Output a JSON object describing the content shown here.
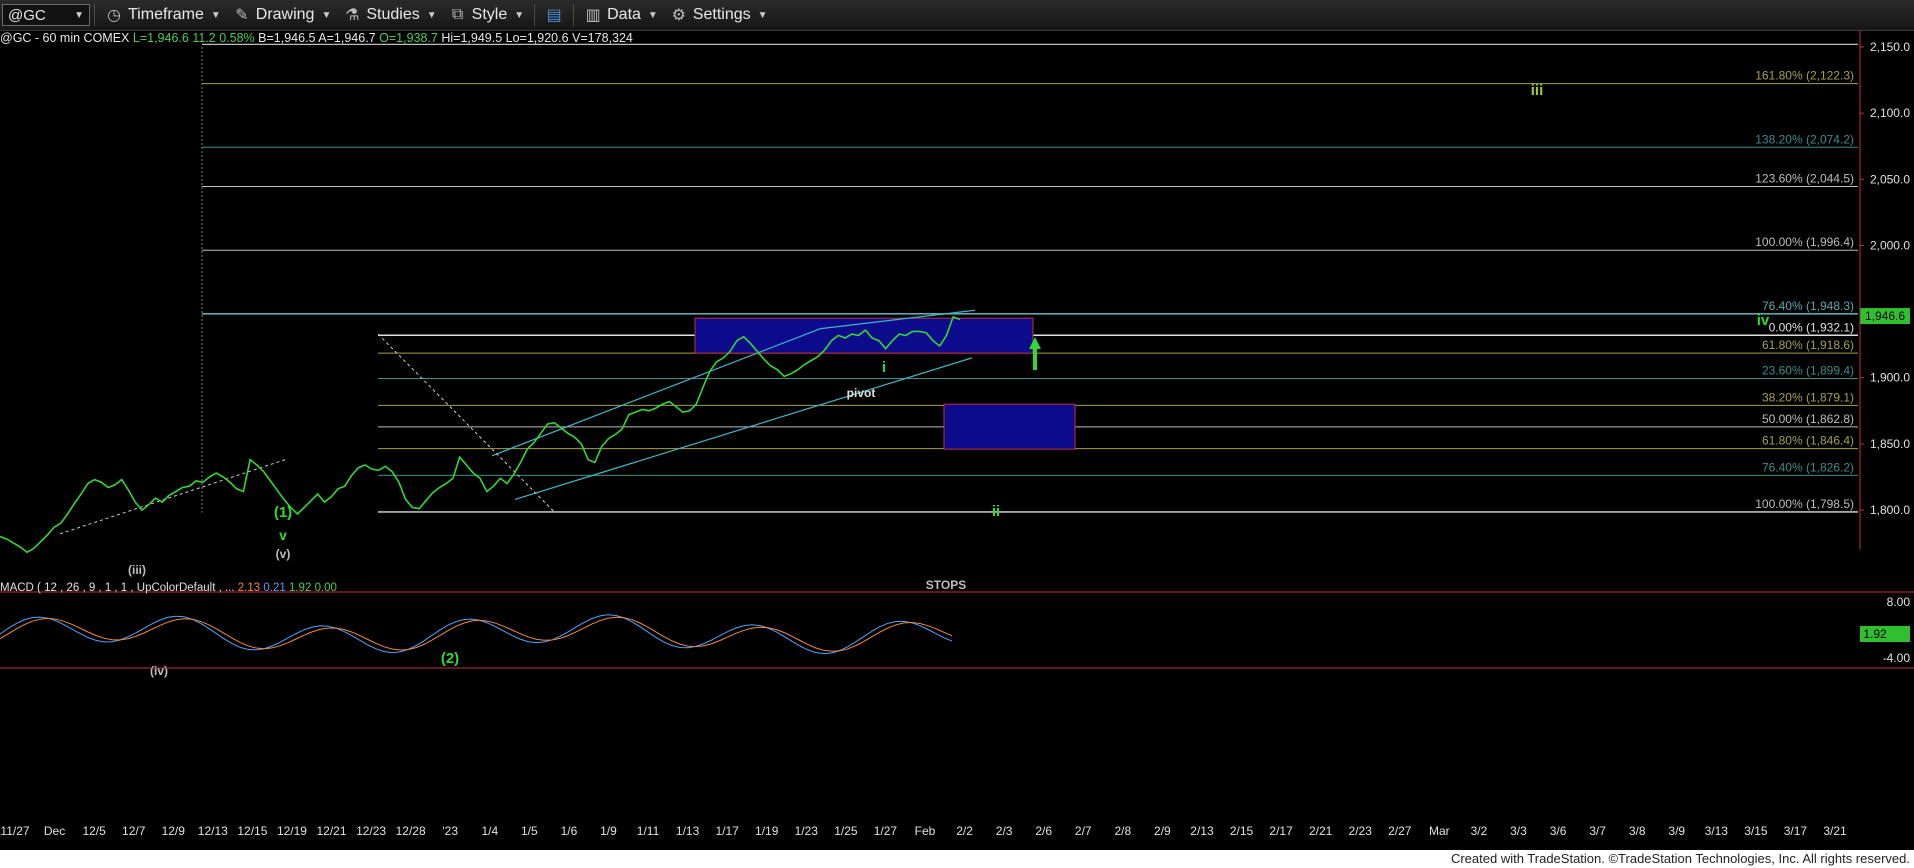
{
  "toolbar": {
    "symbol": "@GC",
    "timeframe": "Timeframe",
    "drawing": "Drawing",
    "studies": "Studies",
    "style": "Style",
    "data": "Data",
    "settings": "Settings"
  },
  "info": {
    "symbol_line": "@GC - 60 min  COMEX",
    "last": "L=1,946.6",
    "change": "11.2",
    "pct": "0.58%",
    "bid": "B=1,946.5",
    "ask": "A=1,946.7",
    "open": "O=1,938.7",
    "high": "Hi=1,949.5",
    "low": "Lo=1,920.6",
    "volume": "V=178,324"
  },
  "macd": {
    "label": "MACD ( 12 , 26 , 9 , 1 , 1 , UpColorDefault , ...",
    "v1": "2.13",
    "v2": "0.21",
    "v3": "1.92",
    "v4": "0.00",
    "ticks": [
      "8.00",
      "-4.00"
    ],
    "current": "1.92"
  },
  "footer": "Created with TradeStation. ©TradeStation Technologies, Inc. All rights reserved.",
  "chart_data": {
    "type": "line",
    "title": "@GC - 60 min",
    "ylim": [
      1770,
      2160
    ],
    "y_ticks": [
      "2,150.0",
      "2,100.0",
      "2,050.0",
      "2,000.0",
      "1,900.0",
      "1,850.0",
      "1,800.0"
    ],
    "last_price": "1,946.6",
    "x_ticks": [
      "11/27",
      "Dec",
      "12/5",
      "12/7",
      "12/9",
      "12/13",
      "12/15",
      "12/19",
      "12/21",
      "12/23",
      "12/28",
      "'23",
      "1/4",
      "1/5",
      "1/6",
      "1/9",
      "1/11",
      "1/13",
      "1/17",
      "1/19",
      "1/23",
      "1/25",
      "1/27",
      "Feb",
      "2/2",
      "2/3",
      "2/6",
      "2/7",
      "2/8",
      "2/9",
      "2/13",
      "2/15",
      "2/17",
      "2/21",
      "2/23",
      "2/27",
      "Mar",
      "3/2",
      "3/3",
      "3/6",
      "3/7",
      "3/8",
      "3/9",
      "3/13",
      "3/15",
      "3/17",
      "3/21"
    ],
    "series": [
      {
        "values": [
          1780,
          1778,
          1775,
          1772,
          1768,
          1771,
          1776,
          1781,
          1787,
          1790,
          1797,
          1805,
          1812,
          1820,
          1823,
          1821,
          1817,
          1819,
          1823,
          1815,
          1806,
          1800,
          1804,
          1809,
          1806,
          1811,
          1814,
          1817,
          1818,
          1822,
          1821,
          1825,
          1828,
          1825,
          1821,
          1816,
          1814,
          1838,
          1834,
          1829,
          1822,
          1815,
          1808,
          1802,
          1797,
          1802,
          1807,
          1812,
          1806,
          1810,
          1816,
          1818,
          1826,
          1832,
          1834,
          1831,
          1830,
          1833,
          1829,
          1821,
          1808,
          1802,
          1801,
          1807,
          1813,
          1817,
          1820,
          1824,
          1840,
          1834,
          1828,
          1824,
          1814,
          1818,
          1824,
          1820,
          1827,
          1836,
          1846,
          1851,
          1858,
          1865,
          1866,
          1862,
          1858,
          1855,
          1850,
          1838,
          1836,
          1848,
          1854,
          1857,
          1861,
          1872,
          1874,
          1876,
          1875,
          1877,
          1880,
          1882,
          1878,
          1874,
          1875,
          1880,
          1893,
          1905,
          1912,
          1915,
          1920,
          1928,
          1931,
          1926,
          1920,
          1914,
          1909,
          1906,
          1901,
          1903,
          1906,
          1910,
          1913,
          1916,
          1921,
          1928,
          1932,
          1930,
          1933,
          1932,
          1936,
          1930,
          1928,
          1922,
          1928,
          1933,
          1932,
          1935,
          1935,
          1934,
          1928,
          1924,
          1932,
          1946,
          1944
        ]
      }
    ],
    "fib_levels": [
      {
        "label": "161.80% (2,122.3)",
        "value": 2122.3
      },
      {
        "label": "138.20% (2,074.2)",
        "value": 2074.2
      },
      {
        "label": "123.60% (2,044.5)",
        "value": 2044.5
      },
      {
        "label": "100.00% (1,996.4)",
        "value": 1996.4
      },
      {
        "label": "76.40% (1,948.3)",
        "value": 1948.3
      },
      {
        "label": "0.00% (1,932.1)",
        "value": 1932.1
      },
      {
        "label": "61.80% (1,918.6)",
        "value": 1918.6
      },
      {
        "label": "23.60% (1,899.4)",
        "value": 1899.4
      },
      {
        "label": "38.20% (1,879.1)",
        "value": 1879.1
      },
      {
        "label": "50.00% (1,862.8)",
        "value": 1862.8
      },
      {
        "label": "61.80% (1,846.4)",
        "value": 1846.4
      },
      {
        "label": "76.40% (1,826.2)",
        "value": 1826.2
      },
      {
        "label": "100.00% (1,798.5)",
        "value": 1798.5
      }
    ],
    "annotations": [
      "iii",
      "iv",
      "i",
      "ii",
      "pivot",
      "STOPS",
      "(1)",
      "v",
      "(v)",
      "(iii)",
      "(iv)",
      "(2)"
    ]
  }
}
